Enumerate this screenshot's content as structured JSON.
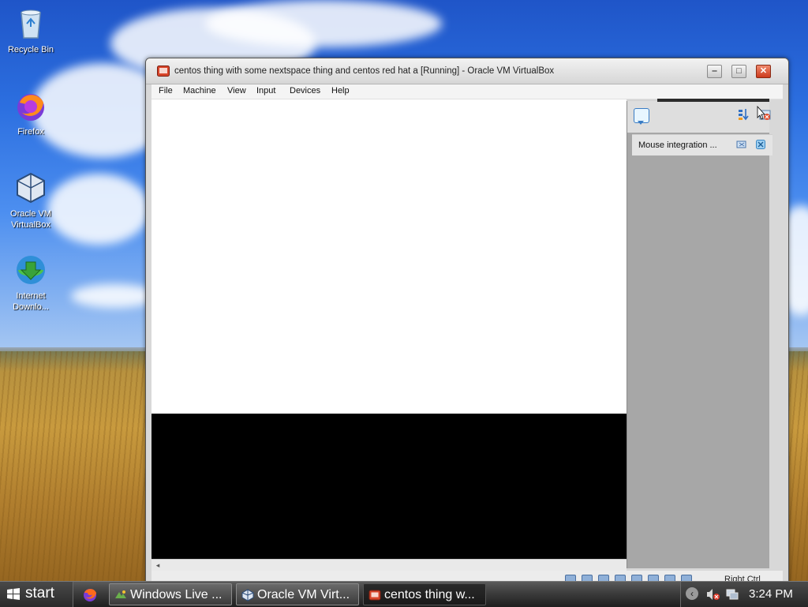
{
  "desktop": {
    "icons": [
      {
        "label": "Recycle Bin",
        "icon": "recycle-bin-icon"
      },
      {
        "label": "Firefox",
        "icon": "firefox-icon"
      },
      {
        "label": "Oracle VM VirtualBox",
        "icon": "virtualbox-icon"
      },
      {
        "label": "Internet Downlo...",
        "icon": "internet-download-manager-icon"
      }
    ]
  },
  "window": {
    "title": "centos thing with some nextspace thing and centos red hat a [Running] - Oracle VM VirtualBox",
    "minimize_label": "‒",
    "maximize_label": "□",
    "close_label": "✕",
    "menu": [
      "File",
      "Machine",
      "View",
      "Input",
      "Devices",
      "Help"
    ],
    "notification_center": {
      "items": [
        {
          "text": "Mouse integration ..."
        }
      ]
    },
    "statusbar": {
      "host_key": "Right Ctrl"
    }
  },
  "taskbar": {
    "start_label": "start",
    "tasks": [
      {
        "label": "Windows Live ...",
        "icon": "windows-live-icon",
        "active": false
      },
      {
        "label": "Oracle VM Virt...",
        "icon": "virtualbox-icon",
        "active": false
      },
      {
        "label": "centos thing w...",
        "icon": "vm-window-icon",
        "active": true
      }
    ],
    "clock": "3:24 PM"
  },
  "colors": {
    "accent": "#3a7cc4",
    "close_button": "#cc3a1c"
  }
}
